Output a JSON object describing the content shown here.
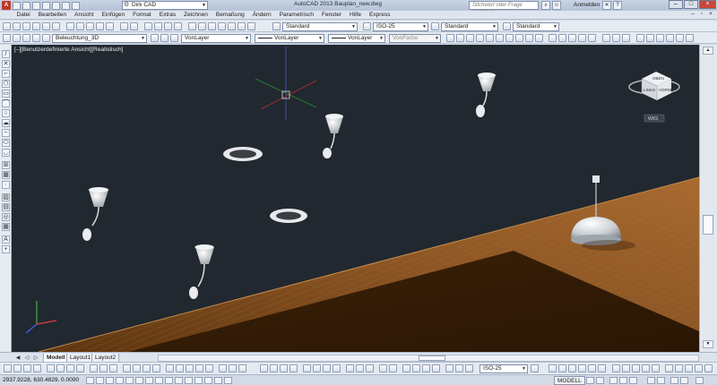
{
  "title_bar": {
    "workspace": "Dirk CAD",
    "app_title": "AutoCAD 2013   Bauplan_new.dwg",
    "search_placeholder": "Stichwort oder Frage eingeben",
    "login_label": "Anmelden",
    "minimize": "–",
    "maximize": "□",
    "close": "×"
  },
  "menu": {
    "items": [
      "Datei",
      "Bearbeiten",
      "Ansicht",
      "Einfügen",
      "Format",
      "Extras",
      "Zeichnen",
      "Bemaßung",
      "Ändern",
      "Parametrisch",
      "Fenster",
      "Hilfe",
      "Express"
    ]
  },
  "toolbar_row1": {
    "text_style": "Standard",
    "dim_style": "ISO-25",
    "table_style": "Standard",
    "mleader_style": "Standard"
  },
  "toolbar_row2": {
    "layer": "Beleuchtung_3D",
    "color": "VonLayer",
    "linetype": "VonLayer",
    "lineweight": "VonLayer",
    "plotstyle": "VonFarbe"
  },
  "viewport": {
    "label": "[–][Benutzerdefinierte Ansicht][Realistisch]",
    "background": "#212830",
    "viewcube_labels": {
      "top": "OBEN",
      "left": "LINKS",
      "front": "VORNE"
    },
    "wcs_label": "WKS"
  },
  "layout_tabs": {
    "tabs": [
      "Modell",
      "Layout1",
      "Layout2"
    ],
    "active": "Modell"
  },
  "bottom_toolbar": {
    "dim_style": "ISO-25"
  },
  "status_bar": {
    "coordinates": "2937.9228, 630.4829, 0.0000",
    "model": "MODELL"
  }
}
